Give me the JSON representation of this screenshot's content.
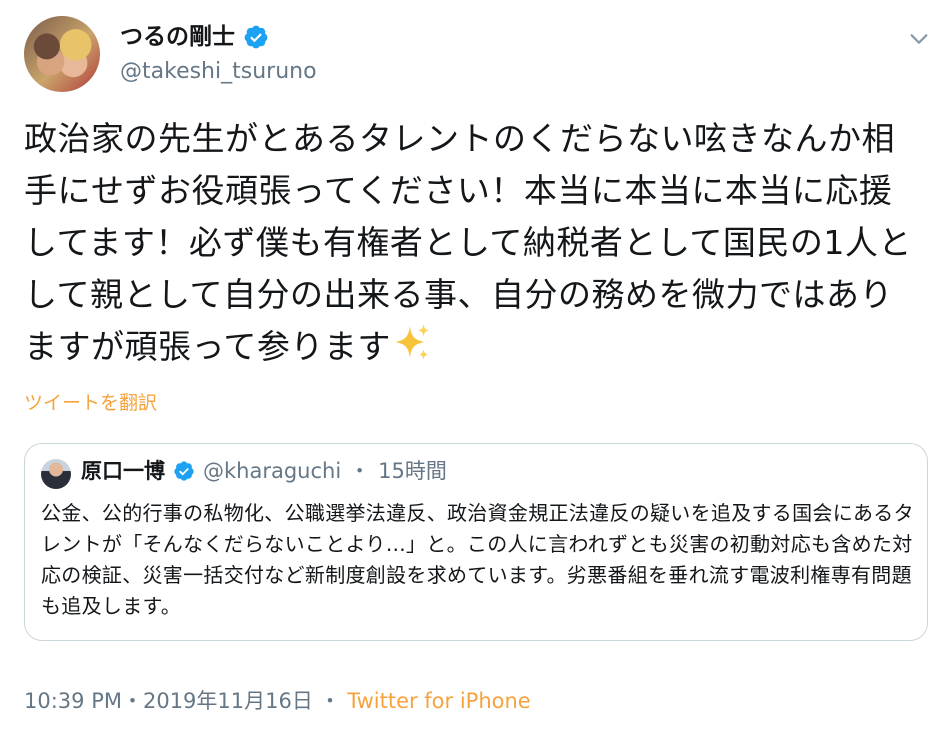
{
  "author": {
    "name": "つるの剛士",
    "handle": "@takeshi_tsuruno"
  },
  "tweet": {
    "text": "政治家の先生がとあるタレントのくだらない呟きなんか相手にせずお役頑張ってください！本当に本当に本当に応援してます！必ず僕も有権者として納税者として国民の1人として親として自分の出来る事、自分の務めを微力ではありますが頑張って参ります",
    "emoji_icon": "sparkles-icon",
    "translate_label": "ツイートを翻訳"
  },
  "quoted": {
    "name": "原口一博",
    "handle": "@kharaguchi",
    "separator": "・",
    "time": "15時間",
    "text": "公金、公的行事の私物化、公職選挙法違反、政治資金規正法違反の疑いを追及する国会にあるタレントが「そんなくだらないことより…」と。この人に言われずとも災害の初動対応も含めた対応の検証、災害一括交付など新制度創設を求めています。劣悪番組を垂れ流す電波利権専有問題も追及します。"
  },
  "footer": {
    "timestamp": "10:39 PM・2019年11月16日",
    "separator": " ・ ",
    "source": "Twitter for iPhone"
  },
  "colors": {
    "accent": "#f6a33f",
    "verified": "#1da1f2",
    "secondary_text": "#657786",
    "border": "#ccd6dd"
  }
}
